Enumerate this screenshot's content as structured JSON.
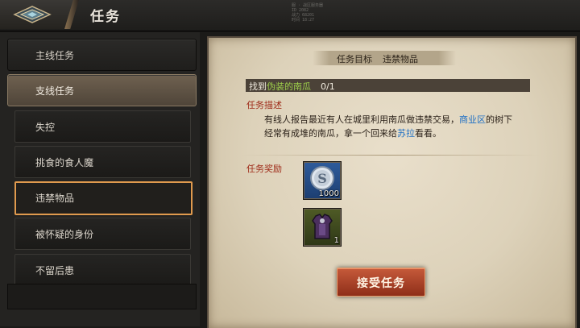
{
  "header": {
    "title": "任务",
    "info_lines": [
      "服 · 战区服务器",
      "ID 2082",
      "战力 68201",
      "时间 18:27"
    ]
  },
  "sidebar": {
    "tabs": [
      {
        "label": "主线任务"
      },
      {
        "label": "支线任务"
      }
    ],
    "quests": [
      {
        "label": "失控"
      },
      {
        "label": "挑食的食人魔"
      },
      {
        "label": "违禁物品"
      },
      {
        "label": "被怀疑的身份"
      },
      {
        "label": "不留后患"
      }
    ]
  },
  "detail": {
    "objective_label": "任务目标",
    "objective_value": "违禁物品",
    "goal_prefix": "找到",
    "goal_target": "伪装的南瓜",
    "goal_progress": "0/1",
    "desc_title": "任务描述",
    "desc_part1": "有线人报告最近有人在城里利用南瓜做违禁交易，",
    "desc_hl1": "商业区",
    "desc_part2": "的树下经常有成堆的南瓜，拿一个回来给",
    "desc_hl2": "苏拉",
    "desc_part3": "看看。",
    "reward_title": "任务奖励",
    "rewards": [
      {
        "icon": "silver-coin-icon",
        "qty": "1000"
      },
      {
        "icon": "armor-vest-icon",
        "qty": "1"
      }
    ],
    "accept_label": "接受任务"
  },
  "colors": {
    "accent_orange": "#e09a4e",
    "goal_highlight": "#9ed04a",
    "link_blue": "#1e6fc4",
    "section_red": "#9e2a18",
    "button_red": "#b04a2c"
  }
}
